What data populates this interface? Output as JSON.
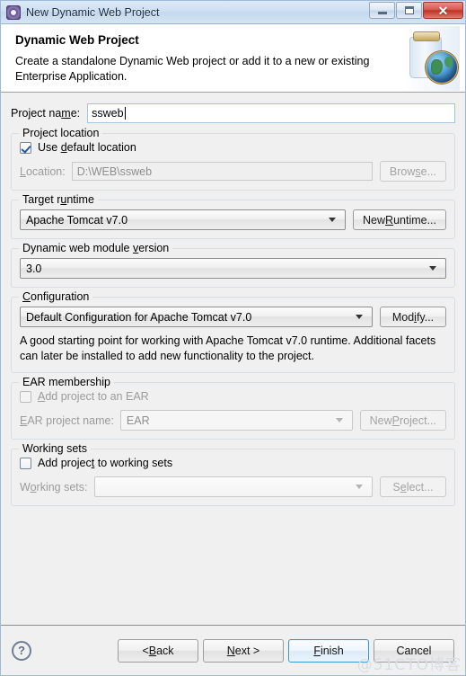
{
  "window": {
    "title": "New Dynamic Web Project",
    "icon": "project-gear-icon",
    "minimize_label": "Minimize",
    "maximize_label": "Maximize",
    "close_label": "Close"
  },
  "banner": {
    "title": "Dynamic Web Project",
    "description": "Create a standalone Dynamic Web project or add it to a new or existing Enterprise Application.",
    "art": "jar-globe-icon"
  },
  "project_name": {
    "label": "Project name:",
    "label_pre": "Project na",
    "label_mnemonic": "m",
    "label_post": "e:",
    "value": "ssweb",
    "placeholder": ""
  },
  "project_location": {
    "legend": "Project location",
    "use_default": {
      "label_pre": "Use ",
      "label_mnemonic": "d",
      "label_post": "efault location",
      "label": "Use default location",
      "checked": true,
      "enabled": true
    },
    "location": {
      "label_mnemonic": "L",
      "label_post": "ocation:",
      "label": "Location:",
      "value": "D:\\WEB\\ssweb",
      "enabled": false
    },
    "browse_button": {
      "label_pre": "Brow",
      "label_mnemonic": "s",
      "label_post": "e...",
      "label": "Browse...",
      "enabled": false
    }
  },
  "target_runtime": {
    "legend_pre": "Target r",
    "legend_mnemonic": "u",
    "legend_post": "ntime",
    "legend": "Target runtime",
    "value": "Apache Tomcat v7.0",
    "new_button": {
      "label_pre": "New ",
      "label_mnemonic": "R",
      "label_post": "untime...",
      "label": "New Runtime..."
    }
  },
  "module_version": {
    "legend_pre": "Dynamic web module ",
    "legend_mnemonic": "v",
    "legend_post": "ersion",
    "legend": "Dynamic web module version",
    "value": "3.0"
  },
  "configuration": {
    "legend_mnemonic": "C",
    "legend_post": "onfiguration",
    "legend": "Configuration",
    "value": "Default Configuration for Apache Tomcat v7.0",
    "modify_button": {
      "label_pre": "Mod",
      "label_mnemonic": "i",
      "label_post": "fy...",
      "label": "Modify..."
    },
    "description": "A good starting point for working with Apache Tomcat v7.0 runtime. Additional facets can later be installed to add new functionality to the project."
  },
  "ear_membership": {
    "legend": "EAR membership",
    "add_checkbox": {
      "label_mnemonic": "A",
      "label_post": "dd project to an EAR",
      "label": "Add project to an EAR",
      "checked": false,
      "enabled": false
    },
    "project_name": {
      "label_mnemonic": "E",
      "label_post": "AR project name:",
      "label": "EAR project name:",
      "value": "EAR",
      "enabled": false
    },
    "new_project_button": {
      "label_pre": "New ",
      "label_mnemonic": "P",
      "label_post": "roject...",
      "label": "New Project...",
      "enabled": false
    }
  },
  "working_sets": {
    "legend": "Working sets",
    "add_checkbox": {
      "label_pre": "Add projec",
      "label_mnemonic": "t",
      "label_post": " to working sets",
      "label": "Add project to working sets",
      "checked": false,
      "enabled": true
    },
    "sets": {
      "label_pre": "W",
      "label_mnemonic": "o",
      "label_post": "rking sets:",
      "label": "Working sets:",
      "value": "",
      "enabled": false
    },
    "select_button": {
      "label_pre": "S",
      "label_mnemonic": "e",
      "label_post": "lect...",
      "label": "Select...",
      "enabled": false
    }
  },
  "footer": {
    "help_glyph": "?",
    "back_button": {
      "label_pre": "< ",
      "label_mnemonic": "B",
      "label_post": "ack",
      "label": "< Back",
      "enabled": true
    },
    "next_button": {
      "label_mnemonic": "N",
      "label_post": "ext >",
      "label": "Next >",
      "enabled": true
    },
    "finish_button": {
      "label_pre": "",
      "label_mnemonic": "F",
      "label_post": "inish",
      "label": "Finish",
      "enabled": true,
      "focused": true
    },
    "cancel_button": {
      "label": "Cancel",
      "enabled": true
    }
  },
  "watermark": {
    "text": "@51CTO博客"
  },
  "colors": {
    "dialog_background": "#f0f0f0",
    "banner_background": "#ffffff",
    "titlebar_gradient_top": "#dce9f7",
    "focus_blue": "#3c96d4",
    "close_red": "#bb3226",
    "field_border": "#a6c4df",
    "disabled_text": "#9b9b9b"
  }
}
